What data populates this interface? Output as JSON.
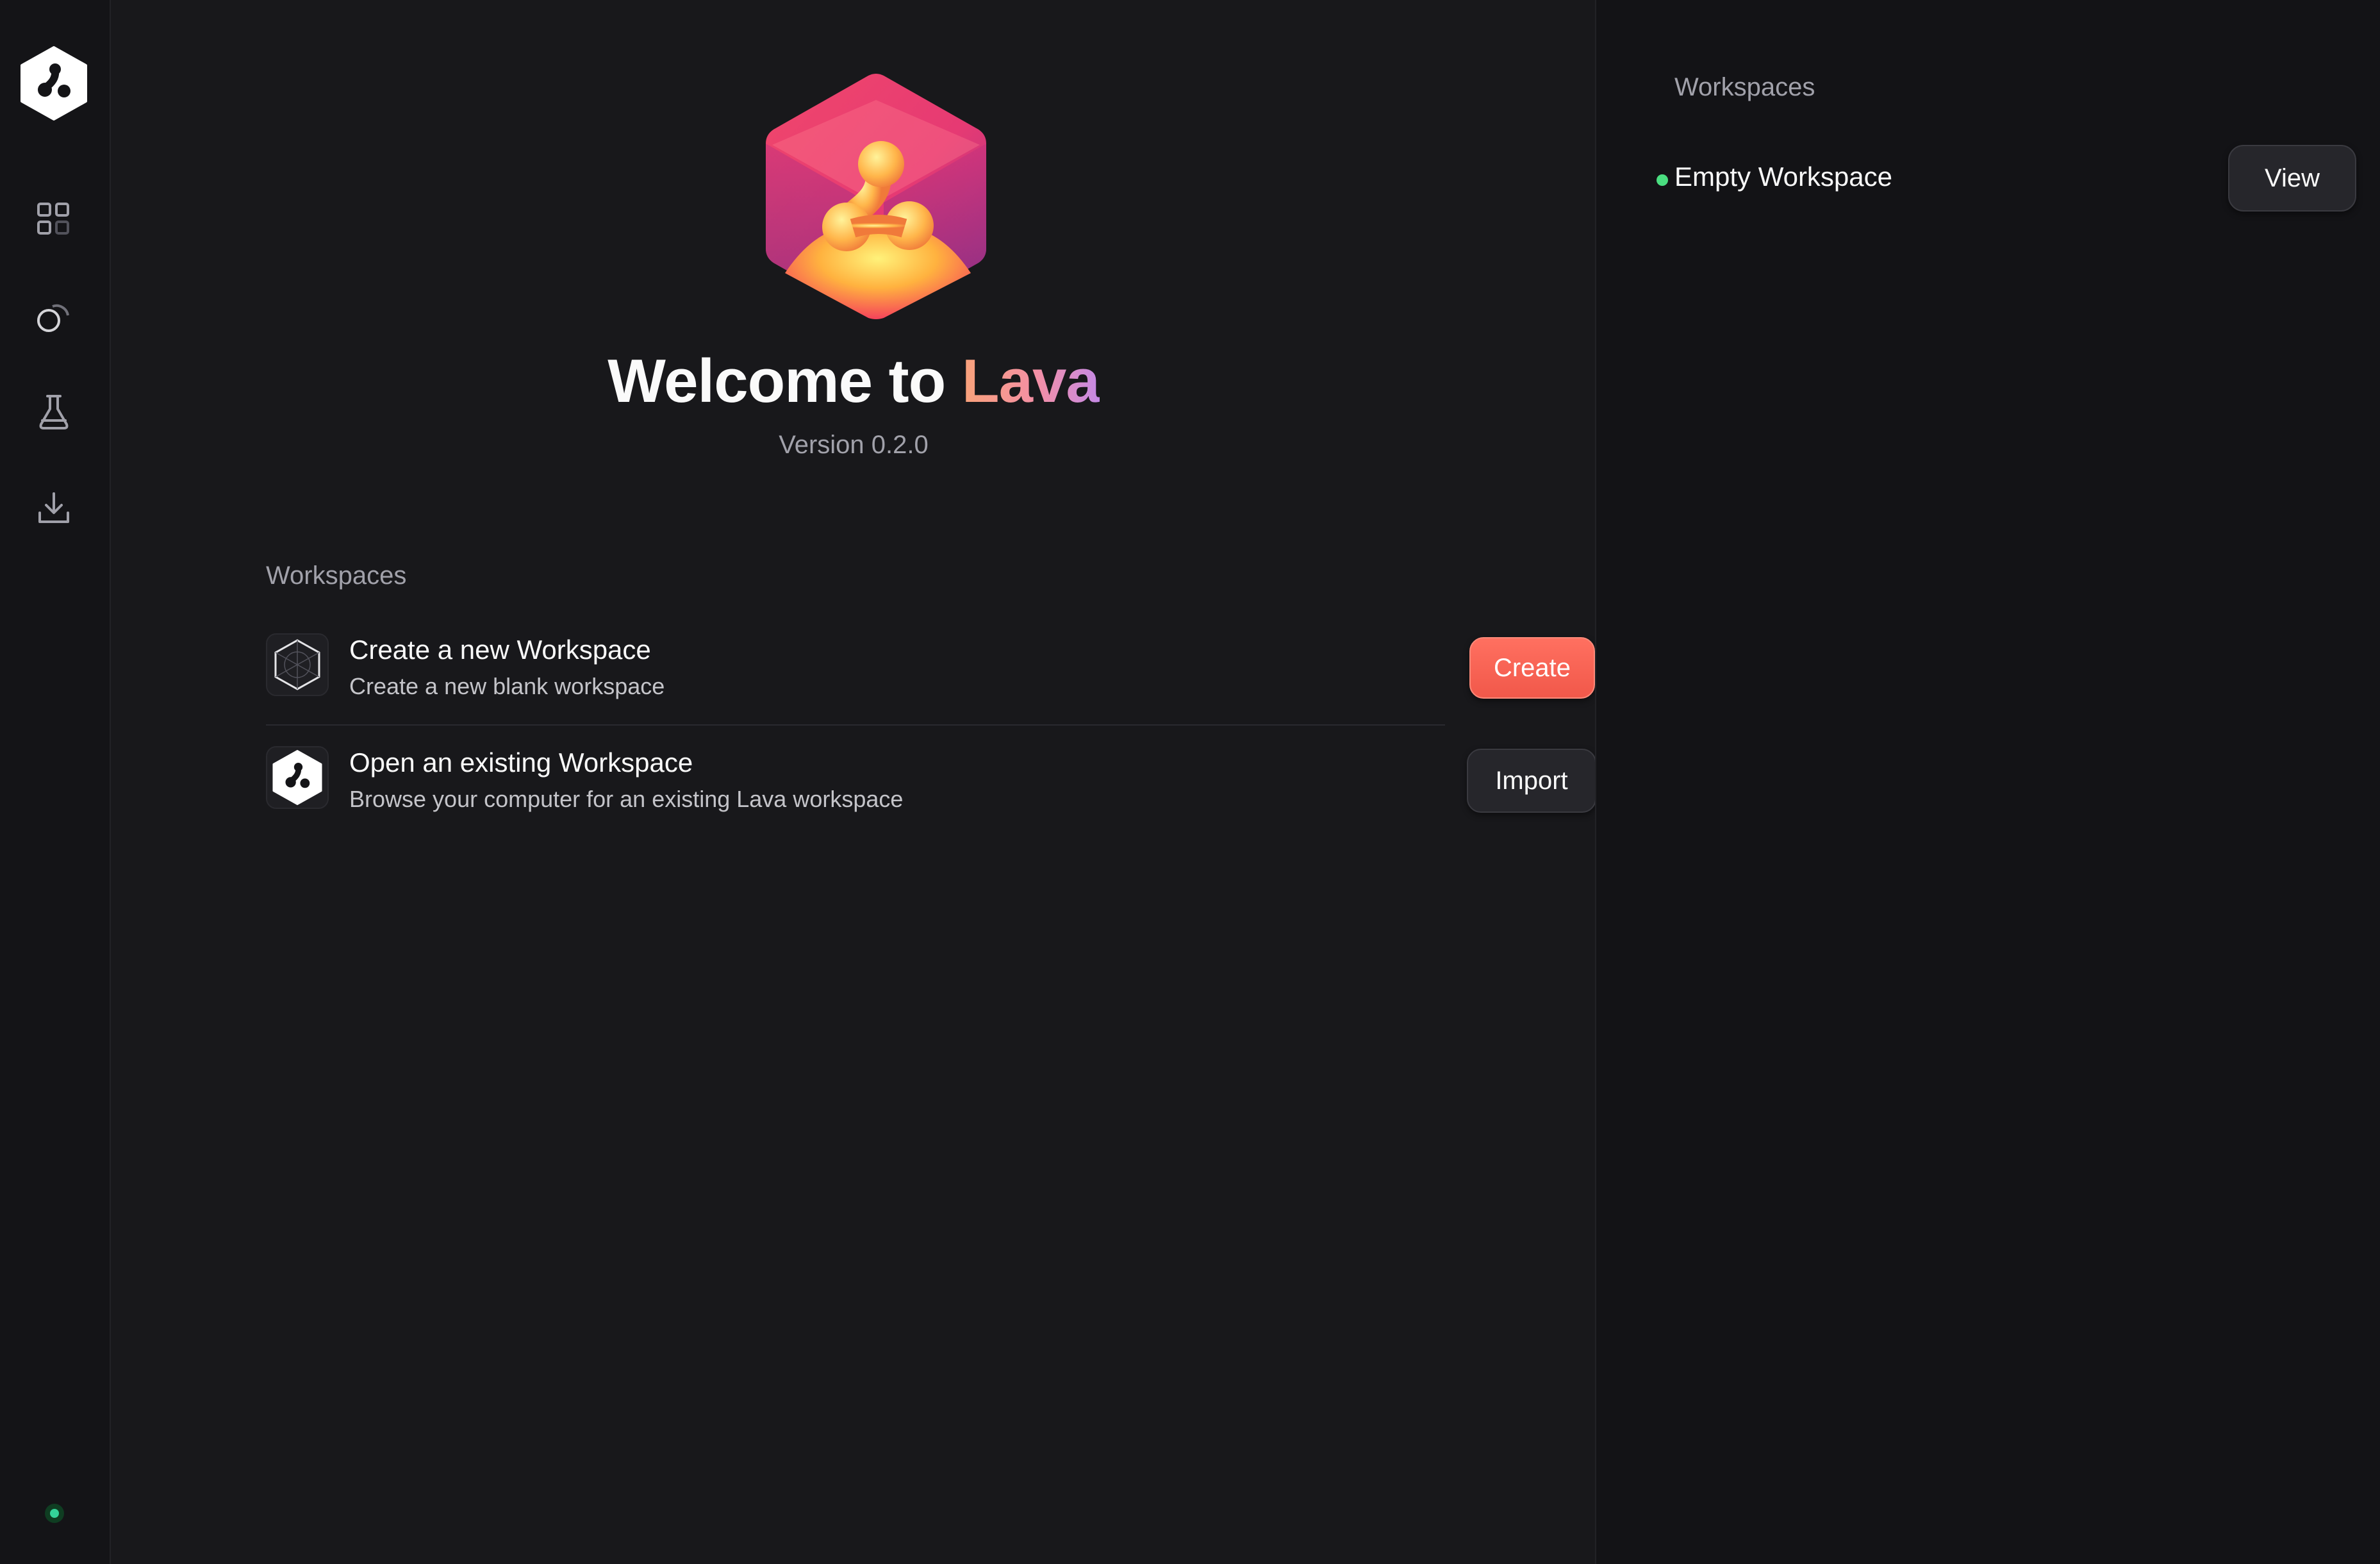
{
  "colors": {
    "accent": "#f1584a",
    "background": "#18181b",
    "status_online": "#4ade80"
  },
  "sidebar": {
    "logo_icon": "lava-logo-icon",
    "items": [
      {
        "name": "dashboard-icon"
      },
      {
        "name": "shapes-icon"
      },
      {
        "name": "flask-icon"
      },
      {
        "name": "download-icon"
      }
    ],
    "status": "online"
  },
  "hero": {
    "welcome_prefix": "Welcome to ",
    "brand": "Lava",
    "version": "Version 0.2.0"
  },
  "workspaces": {
    "label": "Workspaces",
    "actions": [
      {
        "title": "Create a new Workspace",
        "subtitle": "Create a new blank workspace",
        "button": "Create",
        "icon": "hexagon-grid-icon"
      },
      {
        "title": "Open an existing Workspace",
        "subtitle": "Browse your computer for an existing Lava workspace",
        "button": "Import",
        "icon": "lava-logo-icon"
      }
    ]
  },
  "right_panel": {
    "title": "Workspaces",
    "items": [
      {
        "name": "Empty Workspace",
        "button": "View",
        "status": "active"
      }
    ]
  }
}
